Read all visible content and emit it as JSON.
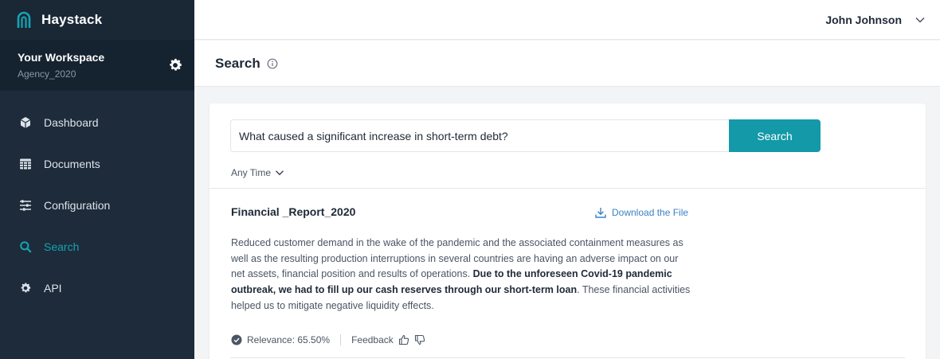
{
  "brand": {
    "name": "Haystack",
    "accent": "#16a3b3"
  },
  "workspace": {
    "title": "Your Workspace",
    "subtitle": "Agency_2020"
  },
  "nav": [
    {
      "label": "Dashboard",
      "icon": "cube-icon"
    },
    {
      "label": "Documents",
      "icon": "table-icon"
    },
    {
      "label": "Configuration",
      "icon": "sliders-icon"
    },
    {
      "label": "Search",
      "icon": "search-icon",
      "active": true
    },
    {
      "label": "API",
      "icon": "gear-icon"
    }
  ],
  "user": {
    "name": "John Johnson"
  },
  "page": {
    "title": "Search"
  },
  "search": {
    "query": "What caused a significant increase in short-term debt?",
    "button": "Search",
    "time_filter": "Any Time"
  },
  "result": {
    "title": "Financial _Report_2020",
    "download": "Download the File",
    "text_before": "Reduced customer demand in the wake of the pandemic and the associated containment measures as well as the resulting production interruptions in several countries are having an adverse impact on our net assets, financial position and results of operations. ",
    "text_bold": "Due to the unforeseen Covid-19 pandemic outbreak, we had to fill up our cash reserves through our short-term loan",
    "text_after": ". These financial activities helped us to mitigate negative liquidity effects.",
    "relevance": "Relevance: 65.50%",
    "feedback": "Feedback"
  }
}
